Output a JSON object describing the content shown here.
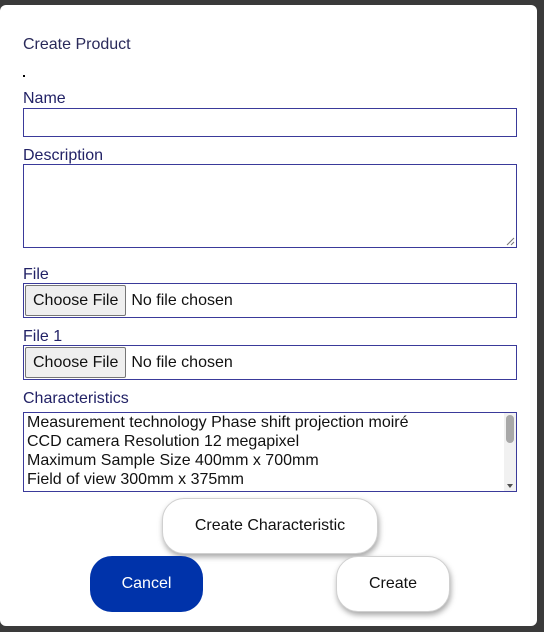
{
  "modal": {
    "title": "Create Product",
    "name_label": "Name",
    "name_value": "",
    "description_label": "Description",
    "description_value": "",
    "file_label": "File",
    "file1_label": "File 1",
    "choose_file_label": "Choose File",
    "no_file_text": "No file chosen",
    "characteristics_label": "Characteristics",
    "characteristics": [
      "Measurement technology Phase shift projection moiré",
      "CCD camera Resolution 12 megapixel",
      "Maximum Sample Size 400mm x 700mm",
      "Field of view 300mm x 375mm"
    ],
    "create_characteristic_label": "Create Characteristic",
    "cancel_label": "Cancel",
    "create_label": "Create"
  },
  "colors": {
    "cancel_bg": "#0033aa",
    "border": "#3a3a9a",
    "backdrop": "#3a3a3a"
  }
}
